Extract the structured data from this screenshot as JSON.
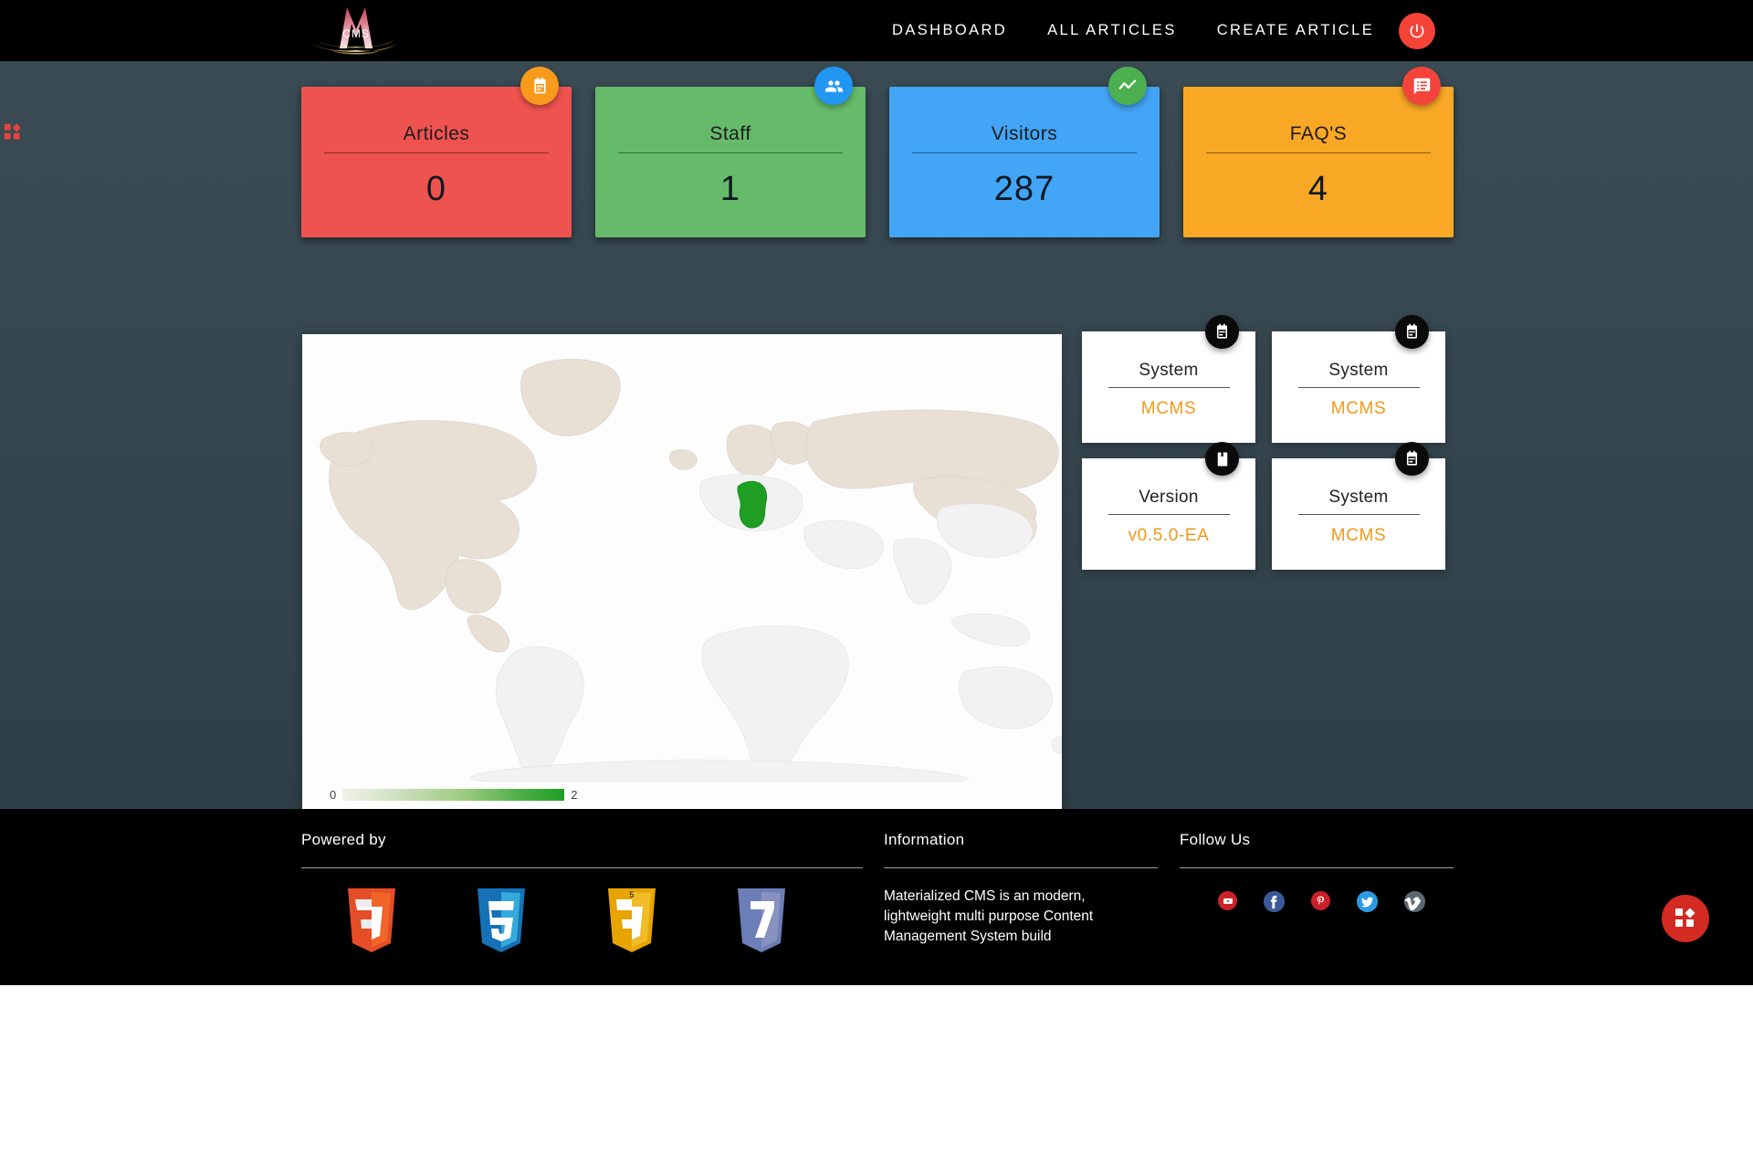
{
  "header": {
    "logo_text": "CMS",
    "logo_name": "materialized-cms-logo",
    "nav": [
      {
        "label": "DASHBOARD",
        "name": "nav-dashboard"
      },
      {
        "label": "ALL ARTICLES",
        "name": "nav-all-articles"
      },
      {
        "label": "CREATE ARTICLE",
        "name": "nav-create-article"
      }
    ],
    "power_button": {
      "icon": "power-icon",
      "color": "#f44336"
    },
    "background": "#000000"
  },
  "corner_apps_icon": "apps-grid-icon",
  "main": {
    "background": "#37474f",
    "stats": [
      {
        "title": "Articles",
        "value": "0",
        "color": "#ef5350",
        "badge_color": "#f89a1c",
        "badge_icon": "calendar-icon"
      },
      {
        "title": "Staff",
        "value": "1",
        "color": "#66bb6a",
        "badge_color": "#2196f3",
        "badge_icon": "people-icon"
      },
      {
        "title": "Visitors",
        "value": "287",
        "color": "#42a5f5",
        "badge_color": "#4caf50",
        "badge_icon": "trending-up-icon"
      },
      {
        "title": "FAQ'S",
        "value": "4",
        "color": "#f9a825",
        "badge_color": "#f4433b",
        "badge_icon": "chat-list-icon"
      }
    ],
    "map": {
      "legend_min": "0",
      "legend_max": "2",
      "highlighted_country": "Germany",
      "highlight_color": "#1f9e23",
      "panel_background": "#fdfdfd"
    },
    "info_cards": [
      {
        "title": "System",
        "value": "MCMS",
        "badge_icon": "calendar-icon"
      },
      {
        "title": "System",
        "value": "MCMS",
        "badge_icon": "calendar-icon"
      },
      {
        "title": "Version",
        "value": "v0.5.0-EA",
        "badge_icon": "book-icon"
      },
      {
        "title": "System",
        "value": "MCMS",
        "badge_icon": "calendar-icon"
      }
    ],
    "info_accent_color": "#f0991a"
  },
  "footer": {
    "background": "#000000",
    "powered_by": {
      "title": "Powered by",
      "technologies": [
        {
          "name": "html5-logo",
          "label": "5",
          "color": "#e44d26",
          "color_dark": "#f16529"
        },
        {
          "name": "css3-logo",
          "label": "3",
          "color": "#1572b6",
          "color_dark": "#33a9dc"
        },
        {
          "name": "javascript-logo",
          "label": "5",
          "color": "#e8a400",
          "color_dark": "#f0bc28"
        },
        {
          "name": "php7-logo",
          "label": "7",
          "color": "#6c7eb7",
          "color_dark": "#8892bf"
        }
      ]
    },
    "information": {
      "title": "Information",
      "text": "Materialized CMS is an modern, lightweight multi purpose Content Management System build"
    },
    "follow_us": {
      "title": "Follow Us",
      "socials": [
        {
          "name": "youtube-icon",
          "glyph": "▶",
          "color": "#cc2229"
        },
        {
          "name": "facebook-icon",
          "glyph": "f",
          "color": "#3b5998"
        },
        {
          "name": "pinterest-icon",
          "glyph": "P",
          "color": "#cb2027"
        },
        {
          "name": "twitter-icon",
          "glyph": "ᴠ",
          "color": "#2b9ae0"
        },
        {
          "name": "vimeo-icon",
          "glyph": "v",
          "color": "#5c6770"
        }
      ]
    }
  },
  "fab": {
    "icon": "apps-grid-icon",
    "color": "#d32a22"
  }
}
